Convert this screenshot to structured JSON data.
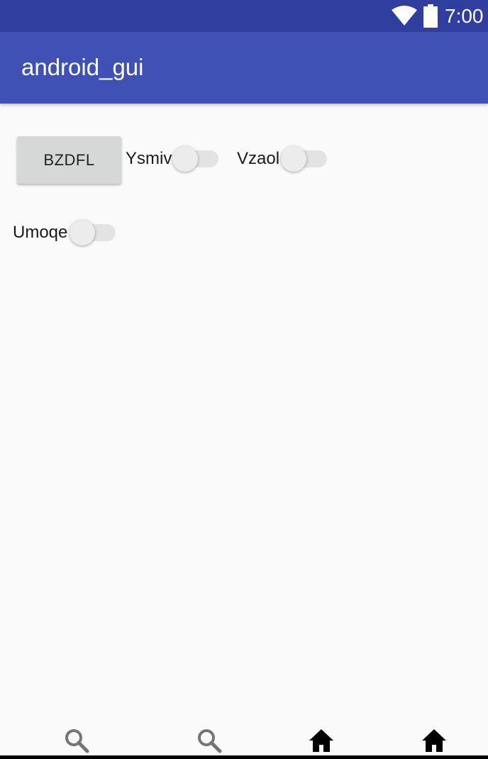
{
  "status_bar": {
    "time": "7:00",
    "icons": [
      "wifi-icon",
      "battery-icon"
    ]
  },
  "app_bar": {
    "title": "android_gui"
  },
  "main": {
    "button_label": "BZDFL",
    "switches": [
      {
        "label": "Ysmiv",
        "checked": false
      },
      {
        "label": "Vzaol",
        "checked": false
      },
      {
        "label": "Umoqe",
        "checked": false
      }
    ]
  },
  "bottom_nav": {
    "icons": [
      "search-icon",
      "search-icon",
      "home-icon",
      "home-icon"
    ]
  },
  "colors": {
    "status_bar": "#303f9f",
    "app_bar": "#3f51b5",
    "background": "#fafafa",
    "button": "#d6d7d7"
  }
}
